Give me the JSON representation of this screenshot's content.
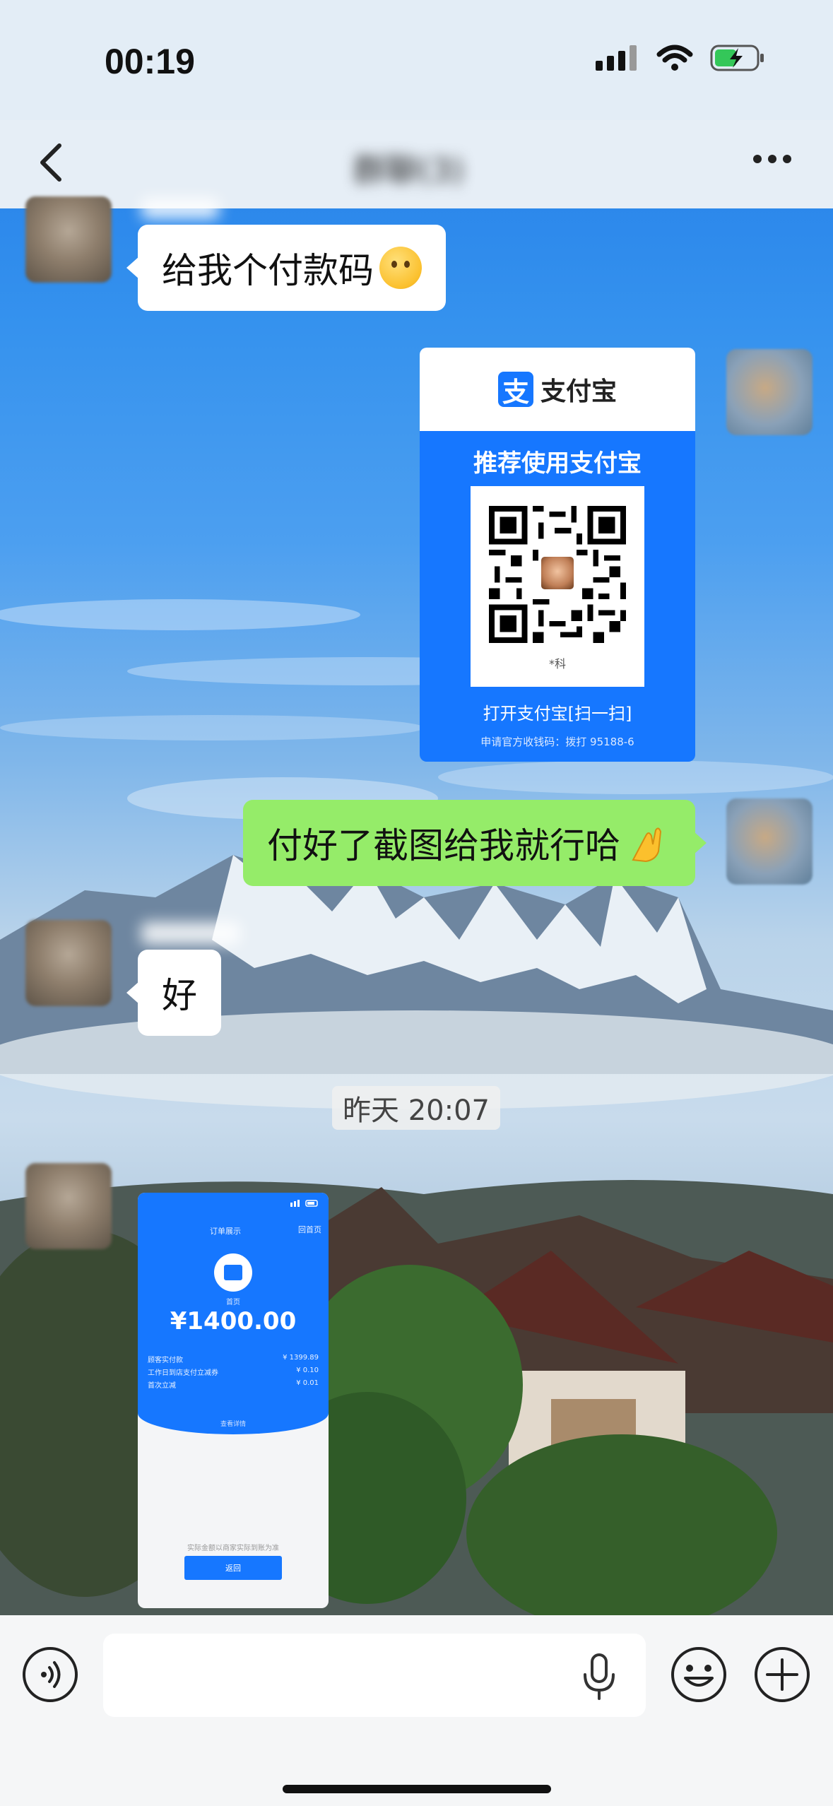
{
  "status_bar": {
    "time": "00:19"
  },
  "nav": {
    "chat_title": "群聊(3)"
  },
  "messages": {
    "m1": {
      "text": "给我个付款码",
      "sender_name": "小白宝"
    },
    "m2": {
      "alipay": {
        "brand": "支付宝",
        "logo_char": "支",
        "recommend": "推荐使用支付宝",
        "name": "*科",
        "open": "打开支付宝[扫一扫]",
        "apply": "申请官方收钱码：拨打 95188-6"
      }
    },
    "m3": {
      "text": "付好了截图给我就行哈"
    },
    "m4": {
      "text": "好"
    },
    "time_divider": "昨天 20:07",
    "m5": {
      "receipt": {
        "title": "订单展示",
        "home": "回首页",
        "store": "首页",
        "amount": "¥1400.00",
        "rows": [
          {
            "label": "顾客实付款",
            "value": "¥ 1399.89"
          },
          {
            "label": "工作日到店支付立减券",
            "value": "¥ 0.10"
          },
          {
            "label": "首次立减",
            "value": "¥ 0.01"
          }
        ],
        "link": "查看详情",
        "note": "实际金额以商家实际到账为准",
        "button": "返回"
      }
    }
  },
  "input": {
    "placeholder": ""
  },
  "colors": {
    "bubble_right": "#95ec69",
    "bubble_left": "#ffffff",
    "alipay_blue": "#1677ff"
  },
  "icons": [
    "back-icon",
    "more-icon",
    "voice-icon",
    "mic-icon",
    "emoji-icon",
    "plus-icon",
    "signal-icon",
    "wifi-icon",
    "battery-icon"
  ]
}
